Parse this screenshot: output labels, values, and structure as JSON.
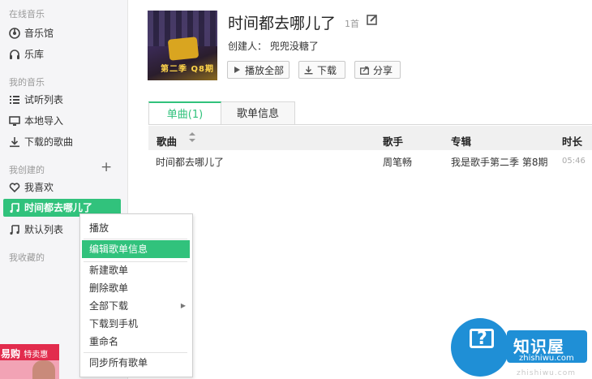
{
  "sidebar": {
    "online_music_title": "在线音乐",
    "online_items": [
      {
        "label": "音乐馆",
        "icon": "disc-icon"
      },
      {
        "label": "乐库",
        "icon": "headphones-icon"
      }
    ],
    "my_music_title": "我的音乐",
    "my_items": [
      {
        "label": "试听列表",
        "icon": "list-icon"
      },
      {
        "label": "本地导入",
        "icon": "monitor-icon"
      },
      {
        "label": "下载的歌曲",
        "icon": "download-icon"
      }
    ],
    "created_title": "我创建的",
    "created_items": [
      {
        "label": "我喜欢",
        "icon": "heart-icon"
      },
      {
        "label": "时间都去哪儿了",
        "icon": "music-note-icon",
        "active": true
      },
      {
        "label": "默认列表",
        "icon": "music-note-icon"
      }
    ],
    "collected_title": "我收藏的"
  },
  "playlist": {
    "cover_caption": "第二季 Q8期",
    "title": "时间都去哪儿了",
    "count": "1首",
    "creator": "创建人：  兜兜没糖了",
    "buttons": {
      "play_all": "播放全部",
      "download": "下载",
      "share": "分享"
    }
  },
  "tabs": [
    {
      "label": "单曲(1)",
      "active": true
    },
    {
      "label": "歌单信息",
      "active": false
    }
  ],
  "table": {
    "headers": {
      "song": "歌曲",
      "artist": "歌手",
      "album": "专辑",
      "duration": "时长"
    },
    "rows": [
      {
        "song": "时间都去哪儿了",
        "artist": "周笔畅",
        "album": "我是歌手第二季 第8期",
        "duration": "05:46"
      }
    ]
  },
  "context_menu": {
    "items": [
      {
        "label": "播放"
      },
      {
        "label": "编辑歌单信息",
        "highlighted": true
      },
      {
        "label": "新建歌单"
      },
      {
        "label": "删除歌单"
      },
      {
        "label": "全部下载",
        "submenu": true
      },
      {
        "label": "下载到手机"
      },
      {
        "label": "重命名"
      },
      {
        "label": "同步所有歌单"
      }
    ]
  },
  "ad": {
    "brand": "易购",
    "tag": "特卖惠"
  },
  "watermark": {
    "title": "知识屋",
    "sub": "zhishiwu.com",
    "url": "zhishiwu.com"
  },
  "colors": {
    "accent": "#31c27c",
    "sidebar_bg": "#f5f5f7",
    "header_bg": "#f0f0f0",
    "watermark_blue": "#1f8fd6"
  }
}
